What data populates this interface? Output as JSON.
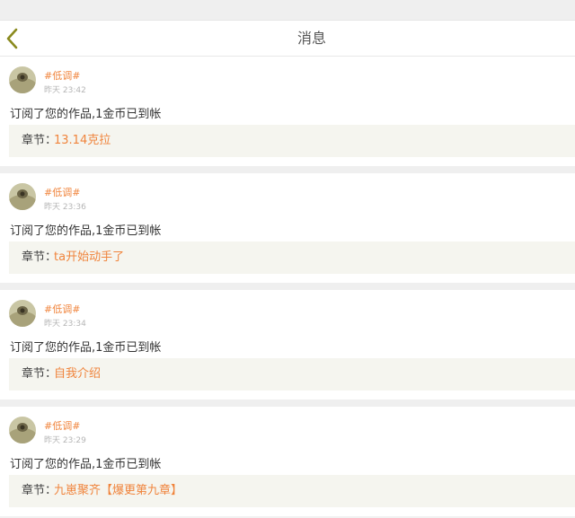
{
  "header": {
    "title": "消息",
    "back_icon": "chevron-left-icon",
    "accent_color": "#8a8a1e"
  },
  "colors": {
    "accent": "#f0843c",
    "chapter_bg": "#f5f5ef",
    "page_bg": "#efefef"
  },
  "messages": [
    {
      "user": "#低调#",
      "time": "昨天 23:42",
      "text": "订阅了您的作品,1金币已到帐",
      "chapter_label": "章节：",
      "chapter_title": "13.14克拉"
    },
    {
      "user": "#低调#",
      "time": "昨天 23:36",
      "text": "订阅了您的作品,1金币已到帐",
      "chapter_label": "章节：",
      "chapter_title": "ta开始动手了"
    },
    {
      "user": "#低调#",
      "time": "昨天 23:34",
      "text": "订阅了您的作品,1金币已到帐",
      "chapter_label": "章节：",
      "chapter_title": "自我介绍"
    },
    {
      "user": "#低调#",
      "time": "昨天 23:29",
      "text": "订阅了您的作品,1金币已到帐",
      "chapter_label": "章节：",
      "chapter_title": "九崽聚齐【爆更第九章】"
    }
  ]
}
